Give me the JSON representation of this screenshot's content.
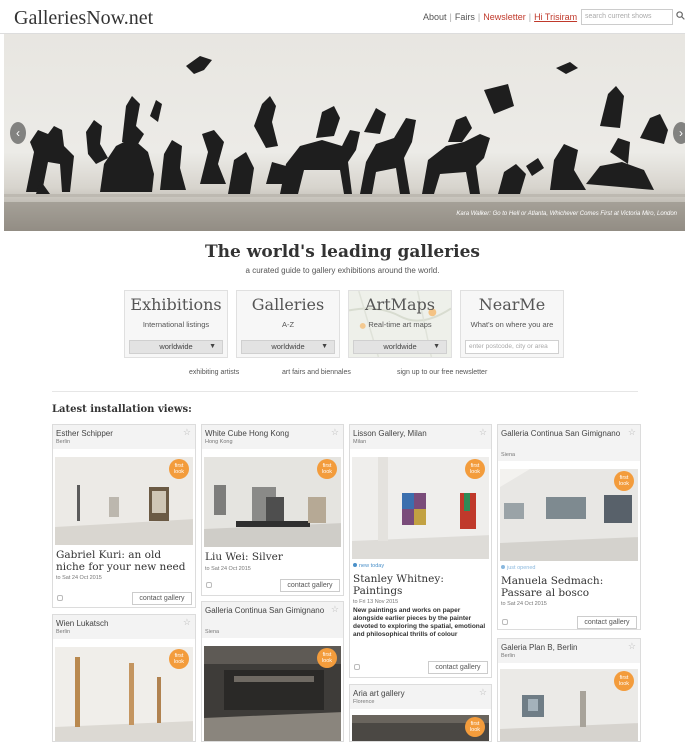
{
  "header": {
    "logo": "GalleriesNow.net",
    "nav": [
      "About",
      "Fairs"
    ],
    "newsletter": "Newsletter",
    "user": "Hi Trisiram",
    "search_placeholder": "search current shows"
  },
  "hero": {
    "caption": "Kara Walker: Go to Hell or Atlanta, Whichever Comes First at Victoria Miro, London"
  },
  "intro": {
    "headline": "The world's leading galleries",
    "subline": "a curated guide to gallery exhibitions around the world."
  },
  "features": [
    {
      "name": "Exhibitions",
      "sub": "International listings",
      "select": "worldwide"
    },
    {
      "name": "Galleries",
      "sub": "A-Z",
      "select": "worldwide"
    },
    {
      "name": "ArtMaps",
      "sub": "Real-time art maps",
      "select": "worldwide"
    },
    {
      "name": "NearMe",
      "sub": "What's on where you are",
      "input_placeholder": "enter postcode, city or area"
    }
  ],
  "sublinks": [
    "exhibiting artists",
    "art fairs and biennales",
    "sign up to our free newsletter"
  ],
  "section_title": "Latest installation views:",
  "badge": {
    "line1": "first",
    "line2": "look"
  },
  "cards": [
    {
      "gallery": "Esther Schipper",
      "city": "Berlin",
      "title": "Gabriel Kuri: an old niche for your new need",
      "date": "to Sat 24 Oct 2015",
      "contact": "contact gallery"
    },
    {
      "gallery": "White Cube Hong Kong",
      "city": "Hong Kong",
      "title": "Liu Wei: Silver",
      "date": "to Sat 24 Oct 2015",
      "contact": "contact gallery"
    },
    {
      "gallery": "Lisson Gallery, Milan",
      "city": "Milan",
      "tag": "new today",
      "title": "Stanley Whitney: Paintings",
      "date": "to Fri 13 Nov 2015",
      "desc": "New paintings and works on paper alongside earlier pieces by the painter devoted to exploring the spatial, emotional and philosophical thrills of colour",
      "contact": "contact gallery"
    },
    {
      "gallery": "Galleria Continua San Gimignano",
      "city": "Siena",
      "tag": "just opened",
      "title": "Manuela Sedmach: Passare al bosco",
      "date": "to Sat 24 Oct 2015",
      "contact": "contact gallery"
    },
    {
      "gallery": "Wien Lukatsch",
      "city": "Berlin"
    },
    {
      "gallery": "Galleria Continua San Gimignano",
      "city": "Siena"
    },
    {
      "gallery": "Aria art gallery",
      "city": "Florence"
    },
    {
      "gallery": "Galeria Plan B, Berlin",
      "city": "Berlin"
    }
  ]
}
